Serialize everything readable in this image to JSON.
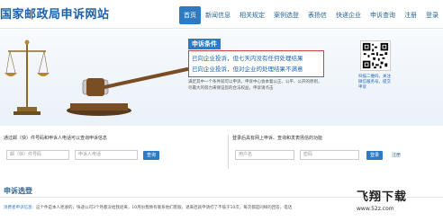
{
  "header": {
    "site_title": "国家邮政局申诉网站",
    "nav": [
      "首页",
      "新闻信息",
      "相关规定",
      "案例选登",
      "表扬信",
      "快递企业",
      "申诉查询",
      "注册",
      "登录"
    ]
  },
  "hero": {
    "title": "申诉条件",
    "rules": [
      "已向企业投诉，但七天内没有任何处理结果",
      "已向企业投诉，但对企业的处理结果不满意"
    ],
    "description": "满足其中一个条件就可以申诉，申诉中心会本着公正、公平、公开的原则，尽最大的努力来保证您的合法权益，申诉请点击",
    "qr_caption": "扫描二维码，关注微信服务号，提交申诉"
  },
  "query_left": {
    "hint": "通过邮（快）件号码和申诉人电话可以查询申诉信息",
    "tracking_placeholder": "邮（快）件号码",
    "phone_placeholder": "申诉人电话",
    "button": "查询"
  },
  "query_right": {
    "hint": "登录后具有网上申诉、查询和发表扬信的功能",
    "username_placeholder": "用户名",
    "password_placeholder": "密码",
    "button": "登录",
    "register": "注册"
  },
  "section": {
    "title": "申诉选登",
    "notice_label": "消费者申诉信息：",
    "notice_text": "这个件是本人拒收的，快递公司3个月都没给我退来，10月份我致有联系他们客服，退来后就申请打了不低于10次，每次都是同样的回答，电话"
  },
  "watermark": {
    "text": "飞翔下载",
    "url": "www.52z.com"
  },
  "colors": {
    "primary": "#2d7bc4",
    "rule_border": "#d24040",
    "title": "#1b62a8"
  }
}
